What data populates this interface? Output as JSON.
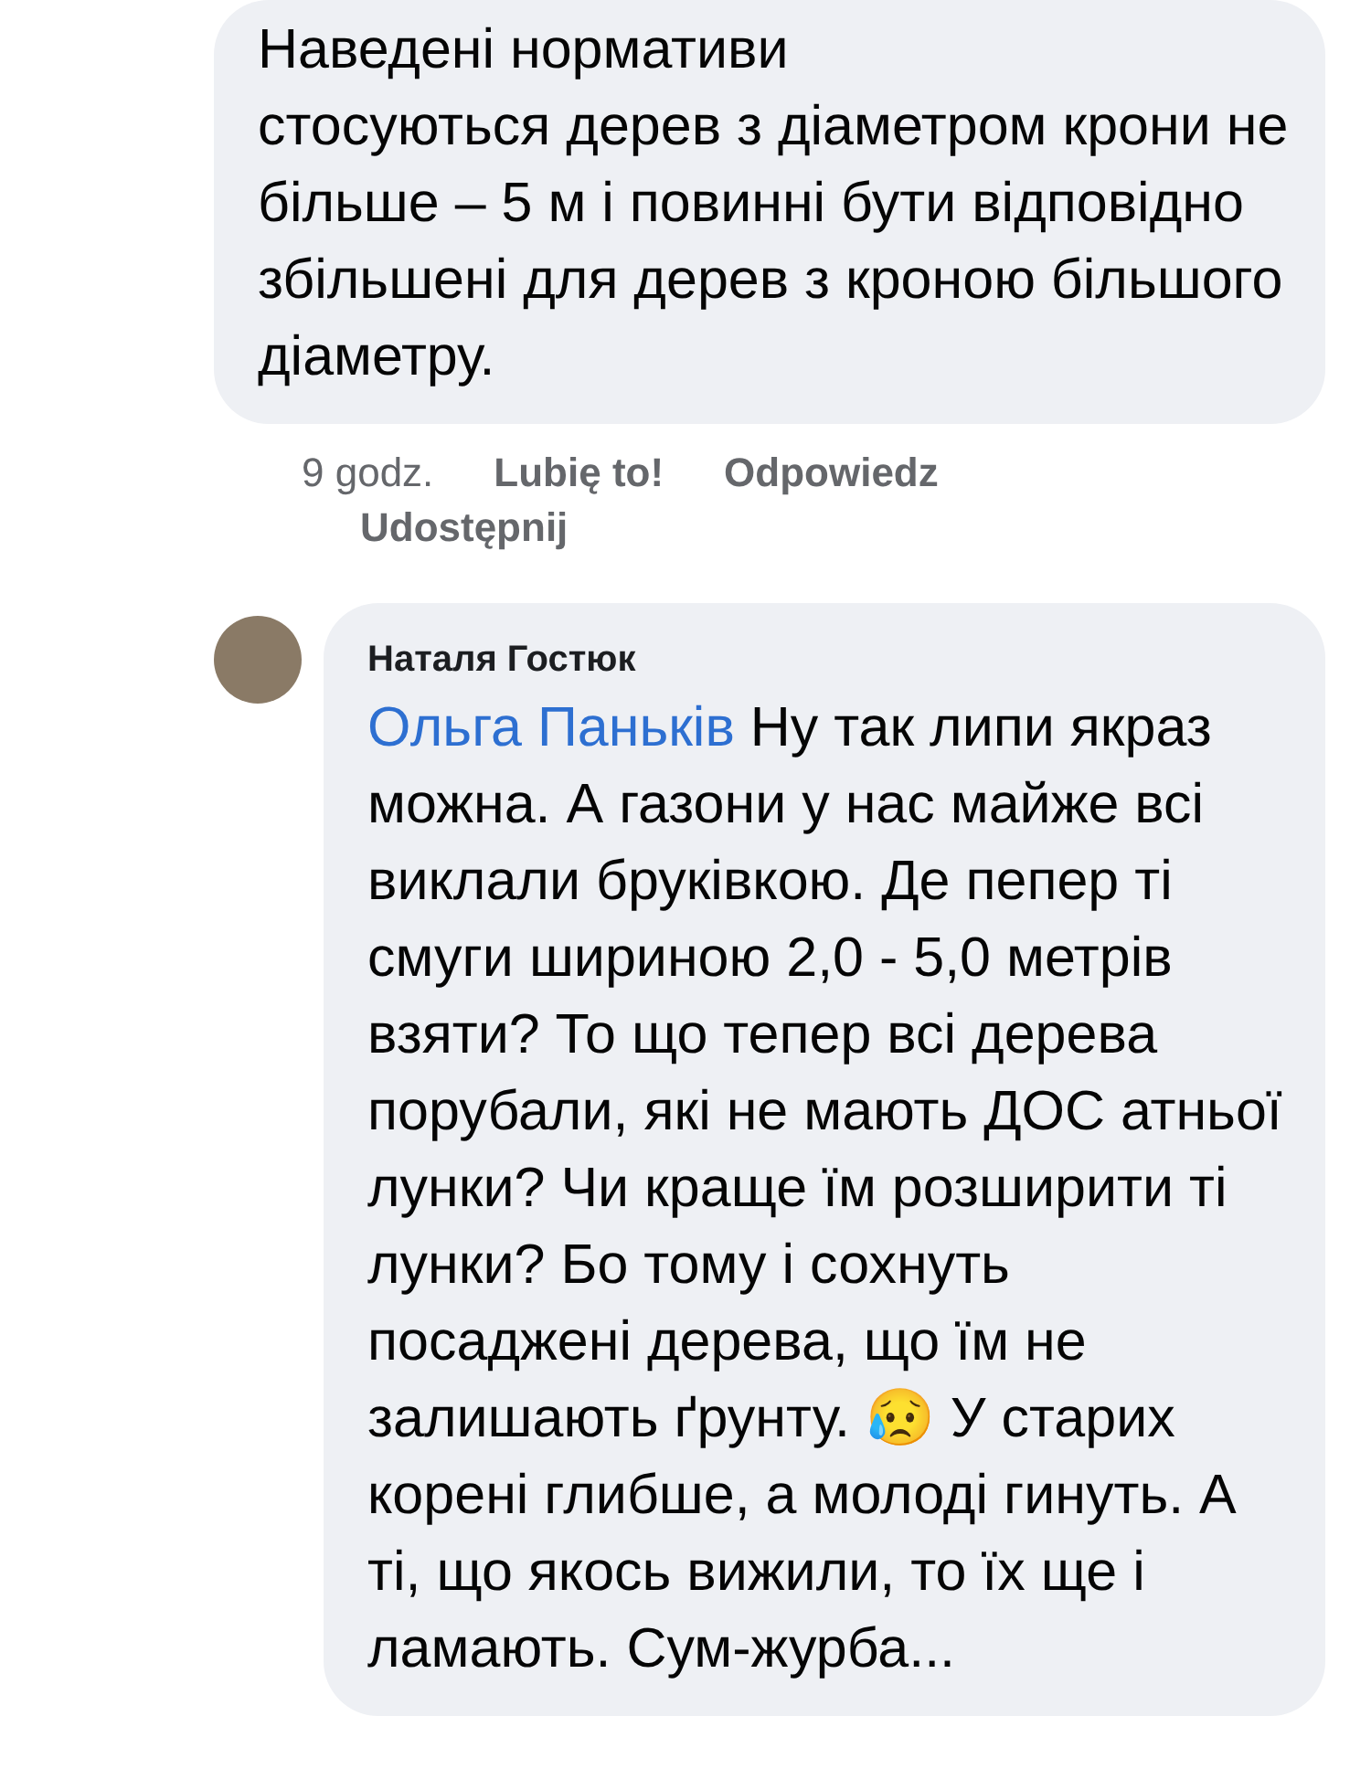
{
  "comments": [
    {
      "text": "Наведені нормативи\nстосуються дерев з діаметром крони не більше – 5 м і повинні бути відповідно збільшені для дерев з кроною більшого діаметру.",
      "actions": {
        "time": "9 godz.",
        "like": "Lubię to!",
        "reply": "Odpowiedz",
        "share": "Udostępnij"
      }
    },
    {
      "author": "Наталя Гостюк",
      "mention": "Ольга Паньків",
      "text": " Ну так липи якраз можна. А газони у нас майже всі виклали бруківкою. Де пепер ті смуги шириною 2,0 - 5,0 метрів взяти? То що тепер всі дерева порубали, які не мають ДОС атньої лунки? Чи краще їм розширити ті\nлунки? Бо тому і сохнуть посаджені дерева, що їм не залишають ґрунту. 😥 У старих корені глибше, а молоді гинуть. А ті, що якось вижили, то їх ще і ламають. Сум-журба..."
    }
  ]
}
